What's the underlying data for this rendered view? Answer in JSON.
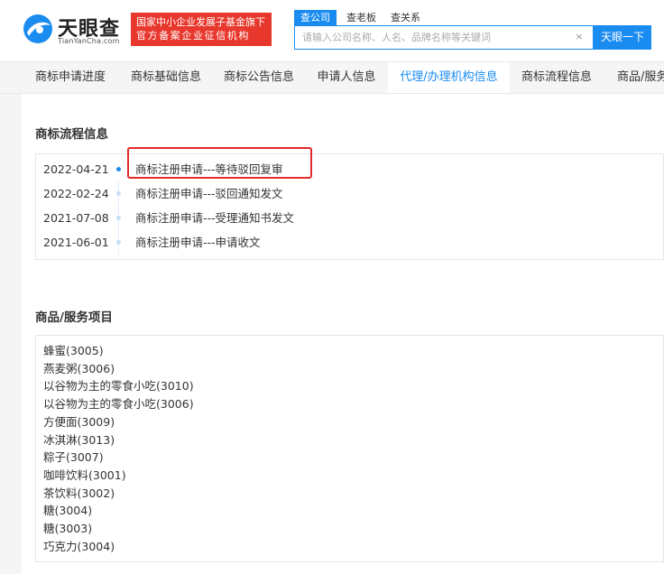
{
  "header": {
    "logo_text": "天眼查",
    "logo_sub": "TianYanCha.com",
    "badge_line1": "国家中小企业发展子基金旗下",
    "badge_line2": "官方备案企业征信机构",
    "search_tabs": [
      "查公司",
      "查老板",
      "查关系"
    ],
    "search_placeholder": "请输入公司名称、人名、品牌名称等关键词",
    "search_button": "天眼一下",
    "clear_symbol": "×"
  },
  "tabs": [
    {
      "label": "商标申请进度"
    },
    {
      "label": "商标基础信息"
    },
    {
      "label": "商标公告信息"
    },
    {
      "label": "申请人信息"
    },
    {
      "label": "代理/办理机构信息"
    },
    {
      "label": "商标流程信息"
    },
    {
      "label": "商品/服务"
    }
  ],
  "active_tab": "代理/办理机构信息",
  "flow_section": {
    "title": "商标流程信息",
    "rows": [
      {
        "date": "2022-04-21",
        "text": "商标注册申请---等待驳回复审"
      },
      {
        "date": "2022-02-24",
        "text": "商标注册申请---驳回通知发文"
      },
      {
        "date": "2021-07-08",
        "text": "商标注册申请---受理通知书发文"
      },
      {
        "date": "2021-06-01",
        "text": "商标注册申请---申请收文"
      }
    ]
  },
  "goods_section": {
    "title": "商品/服务项目",
    "items": [
      "蜂蜜(3005)",
      "燕麦粥(3006)",
      "以谷物为主的零食小吃(3010)",
      "以谷物为主的零食小吃(3006)",
      "方便面(3009)",
      "冰淇淋(3013)",
      "粽子(3007)",
      "咖啡饮料(3001)",
      "茶饮料(3002)",
      "糖(3004)",
      "糖(3003)",
      "巧克力(3004)"
    ]
  },
  "colors": {
    "accent": "#1a8cf0",
    "badge_red": "#e8372c",
    "highlight_red": "#e42a2a"
  }
}
